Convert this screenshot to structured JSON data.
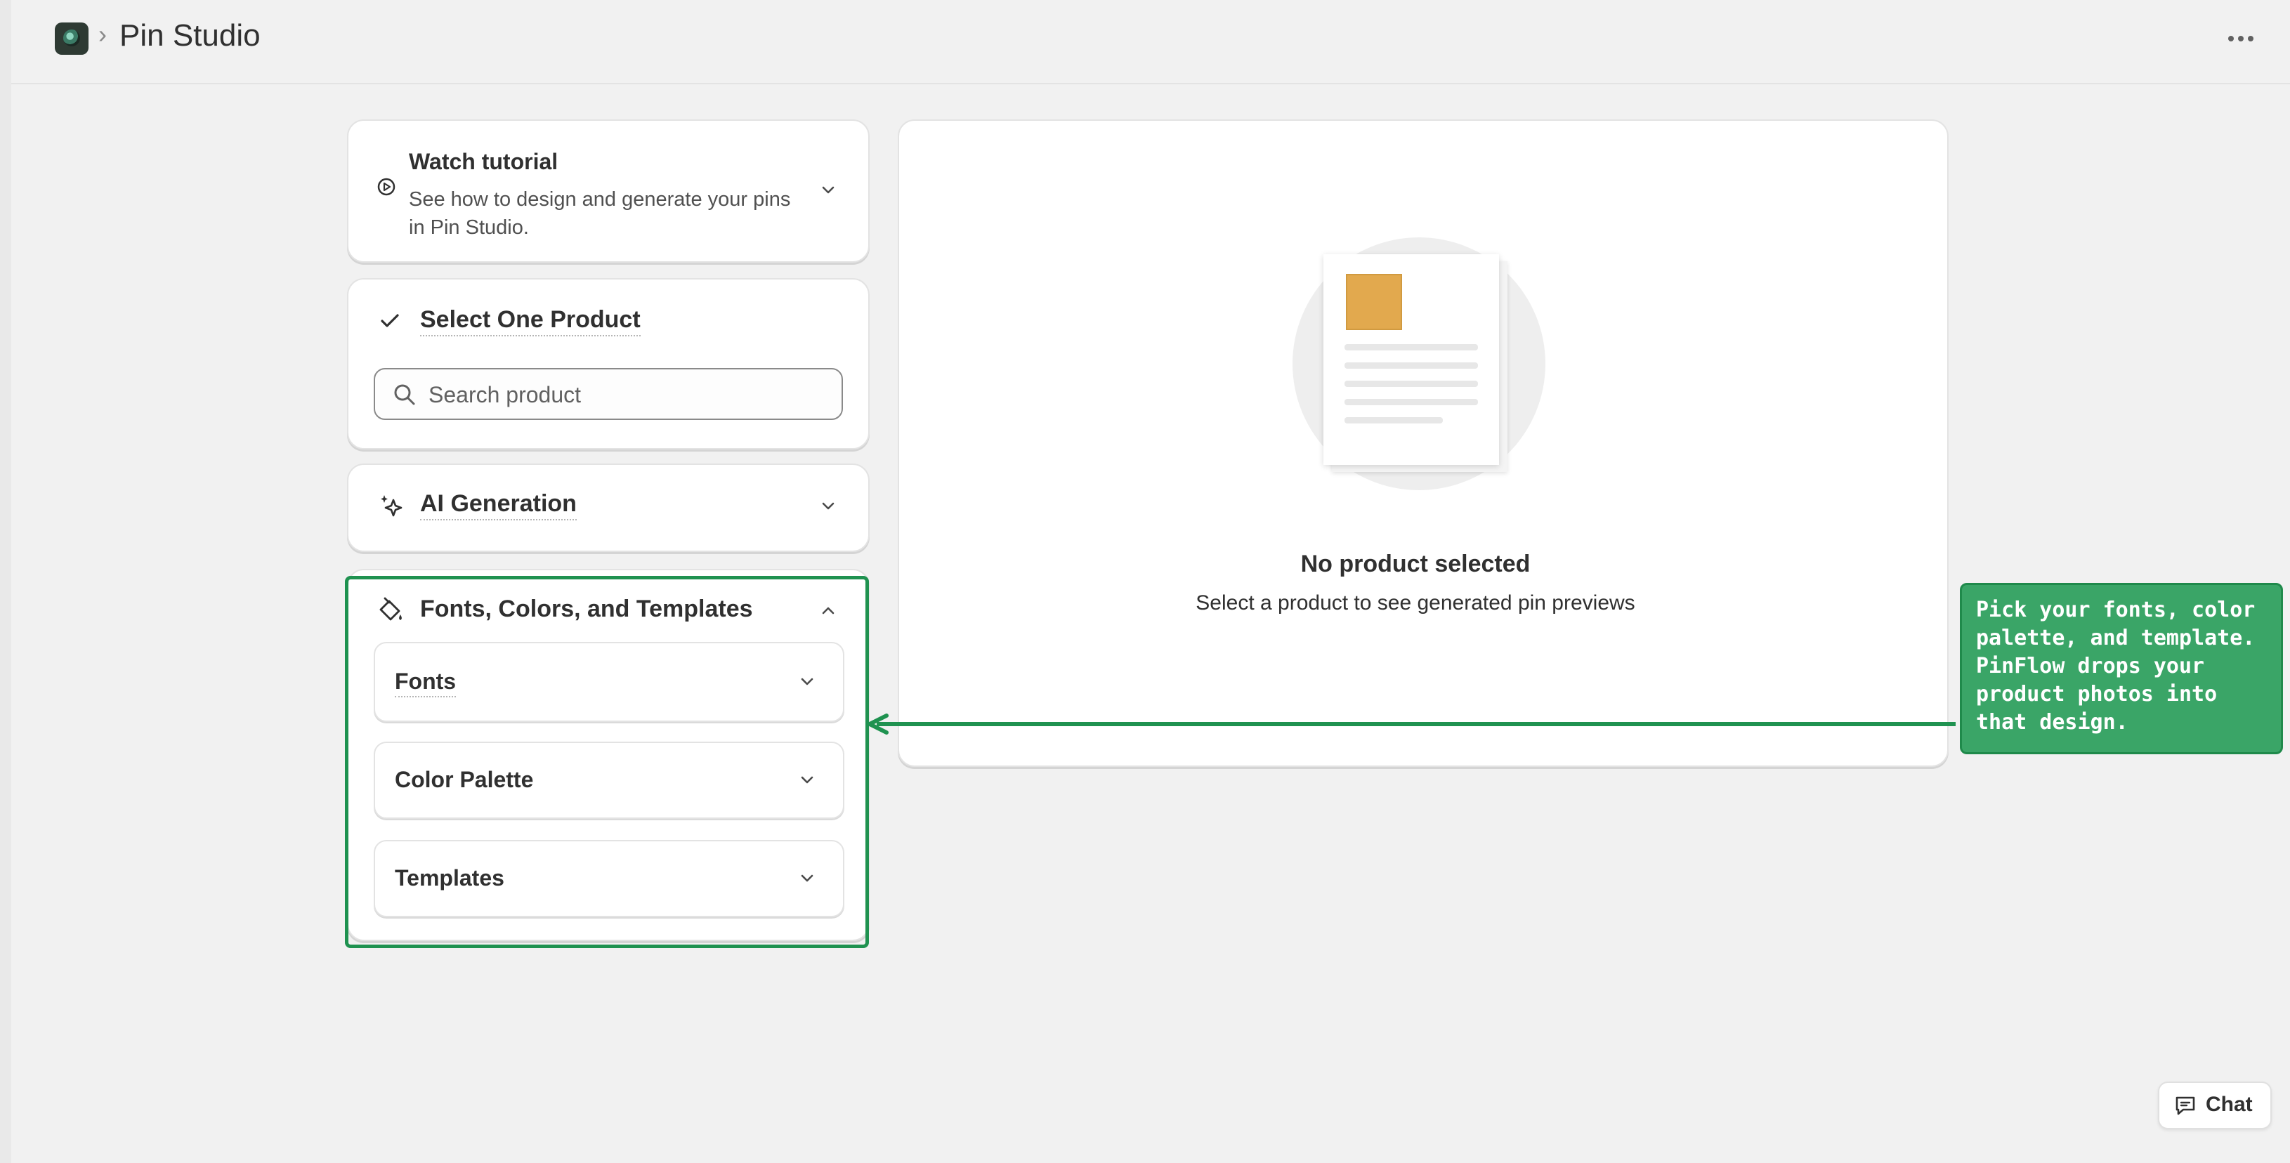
{
  "header": {
    "breadcrumb_separator": "›",
    "title": "Pin Studio"
  },
  "sidebar": {
    "tutorial": {
      "title": "Watch tutorial",
      "description": "See how to design and generate your pins in Pin Studio."
    },
    "select_product": {
      "title": "Select One Product",
      "search_placeholder": "Search product"
    },
    "ai_generation": {
      "title": "AI Generation"
    },
    "fonts_colors_templates": {
      "title": "Fonts, Colors, and Templates",
      "sections": [
        {
          "label": "Fonts"
        },
        {
          "label": "Color Palette"
        },
        {
          "label": "Templates"
        }
      ]
    }
  },
  "preview": {
    "empty_title": "No product selected",
    "empty_description": "Select a product to see generated pin previews"
  },
  "callout": {
    "text": "Pick your fonts, color palette, and template. PinFlow drops your product photos into that design."
  },
  "chat": {
    "label": "Chat"
  },
  "colors": {
    "accent_green": "#1f9250",
    "callout_bg": "#3aa567",
    "placeholder_image": "#e2a94e"
  }
}
